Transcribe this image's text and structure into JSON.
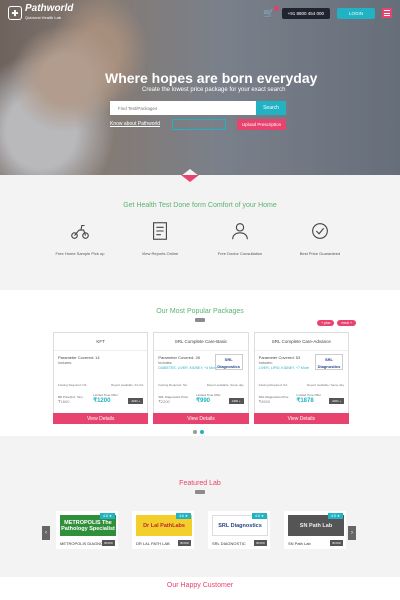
{
  "nav": {
    "logo_name": "Pathworld",
    "logo_tag": "Quickest Health Lab",
    "cart_icon": "cart-icon",
    "phone": "+91 8800 454 000",
    "login_label": "LOGIN",
    "menu_icon": "menu-icon"
  },
  "hero": {
    "headline": "Where hopes are born everyday",
    "subline": "Create the lowest price package for your exact search",
    "search_placeholder": "Find Test/Packages",
    "search_label": "Search",
    "know_label": "Know about Pathworld",
    "upload_label": "Upload Prescription"
  },
  "health": {
    "heading": "Get Health Test Done form Comfort of your Home",
    "features": [
      {
        "label": "Free Home Sample Pick up",
        "icon": "scooter-icon"
      },
      {
        "label": "View Reports Online",
        "icon": "reports-icon"
      },
      {
        "label": "Free Doctor Consultation",
        "icon": "doctor-icon"
      },
      {
        "label": "Best Price Guaranteed",
        "icon": "badge-icon"
      }
    ]
  },
  "packages": {
    "heading": "Our Most Popular Packages",
    "pills": [
      "+ pkw",
      "meal +"
    ],
    "cards": [
      {
        "title": "KFT",
        "param": "Parameter Covered: 14",
        "includes": "Includes:",
        "more": "",
        "lab": "",
        "meta_left": "Fasting Required: NA",
        "meta_right": "Report available: 24 Hrs",
        "orig_label": "Bill Price(Incl. Tax)",
        "orig": "₹1600",
        "offer_label": "Limited Time Offer",
        "offer": "₹1200",
        "add": "ADD +",
        "view": "View Details"
      },
      {
        "title": "SRL Complete Care-Basic",
        "param": "Parameter Covered: 28",
        "includes": "Includes:",
        "more": "DIABETES, LIVER, KIDNEY, +4 More",
        "lab": "SRL Diagnostics",
        "meta_left": "Fasting Required: NA",
        "meta_right": "Report available: Same day",
        "orig_label": "SRL Diagnostics Price",
        "orig": "₹2200",
        "offer_label": "Limited Time Offer",
        "offer": "₹990",
        "add": "ADD +",
        "view": "View Details"
      },
      {
        "title": "SRL Complete Care-Advance",
        "param": "Parameter Covered: 53",
        "includes": "Includes:",
        "more": "LIVER, LIPID, KIDNEY, +7 More",
        "lab": "SRL Diagnostics",
        "meta_left": "Fasting Required: NA",
        "meta_right": "Report available: Same day",
        "orig_label": "SRL Diagnostics Price",
        "orig": "₹4500",
        "offer_label": "Limited Time Offer",
        "offer": "₹1878",
        "add": "ADD +",
        "view": "View Details"
      }
    ]
  },
  "labs": {
    "heading": "Featured Lab",
    "items": [
      {
        "logo": "METROPOLIS The Pathology Specialist",
        "name": "METROPOLIS DIAGNOSTIC",
        "rating": "4.5 ★",
        "book": "BOOK"
      },
      {
        "logo": "Dr Lal PathLabs",
        "name": "DR LAL PATH LAB",
        "rating": "4.6 ★",
        "book": "BOOK"
      },
      {
        "logo": "SRL Diagnostics",
        "name": "SRL DIAGNOSTIC",
        "rating": "4.5 ★",
        "book": "BOOK"
      },
      {
        "logo": "SN Path Lab",
        "name": "SN Path Lab",
        "rating": "4.5 ★",
        "book": "BOOK"
      }
    ]
  },
  "customers": {
    "heading": "Our Happy Customer"
  },
  "colors": {
    "accent": "#21b3c4",
    "brand_pink": "#e8436e",
    "green": "#5db26f"
  }
}
